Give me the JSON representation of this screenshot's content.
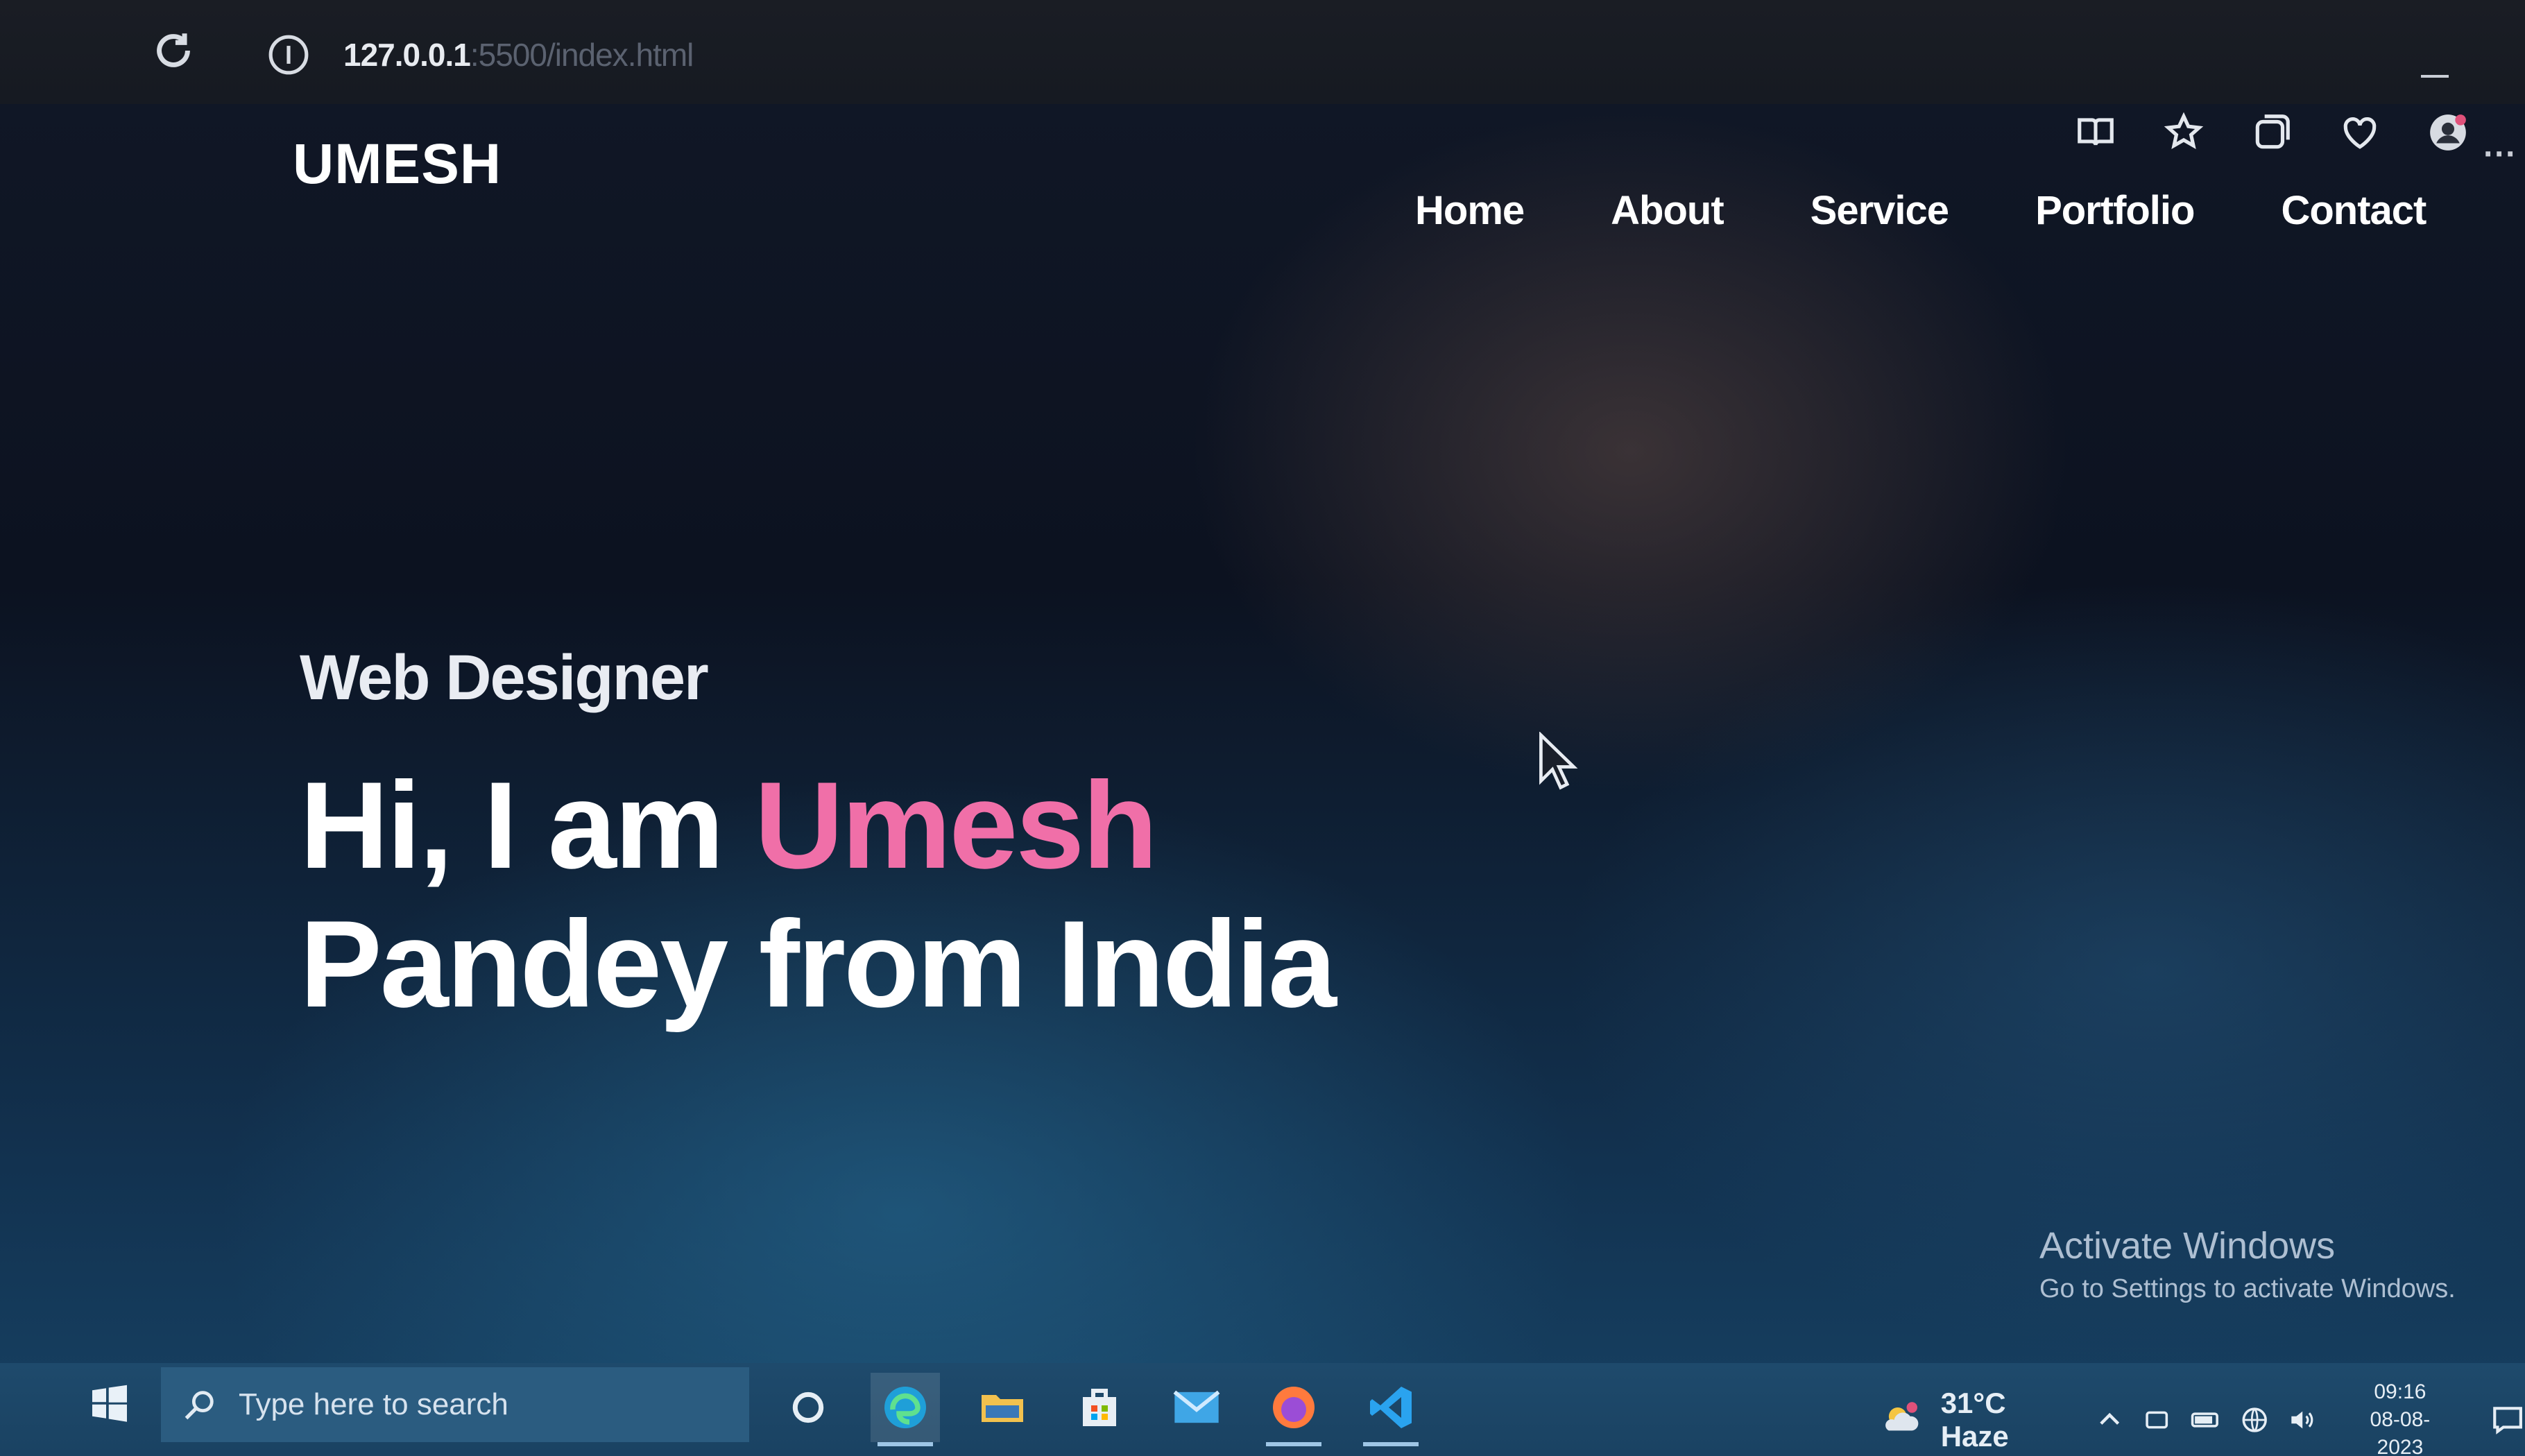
{
  "browser": {
    "url_host": "127.0.0.1",
    "url_path": ":5500/index.html"
  },
  "site": {
    "logo": "UMESH",
    "nav": [
      "Home",
      "About",
      "Service",
      "Portfolio",
      "Contact"
    ],
    "role": "Web Designer",
    "headline_prefix": "Hi, I am ",
    "headline_name": "Umesh",
    "headline_line2": "Pandey from India",
    "accent_color": "#f06fa8"
  },
  "watermark": {
    "title": "Activate Windows",
    "subtitle": "Go to Settings to activate Windows."
  },
  "taskbar": {
    "search_placeholder": "Type here to search",
    "weather": "31°C Haze",
    "time": "09:16",
    "date": "08-08-2023",
    "apps": [
      "cortana-icon",
      "edge-icon",
      "file-explorer-icon",
      "store-icon",
      "mail-icon",
      "firefox-icon",
      "vscode-icon"
    ]
  }
}
